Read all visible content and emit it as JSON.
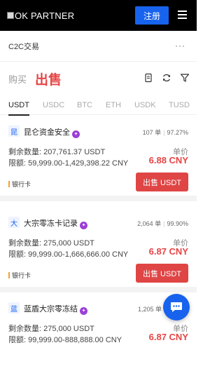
{
  "header": {
    "logo_text": "OK PARTNER",
    "register_label": "注册"
  },
  "subhead": {
    "title": "C2C交易",
    "more": "···"
  },
  "mode_tabs": {
    "buy": "购买",
    "sell": "出售"
  },
  "coins": [
    "USDT",
    "USDC",
    "BTC",
    "ETH",
    "USDK",
    "TUSD"
  ],
  "active_coin": "USDT",
  "listings": [
    {
      "avatar": "昆",
      "name": "昆仑资金安全",
      "orders": "107 单",
      "completion": "97.27%",
      "qty": "剩余数量: 207,761.37 USDT",
      "limit": "限额: 59,999.00-1,429,398.22 CNY",
      "price_label": "单价",
      "price": "6.88 CNY",
      "pay": "银行卡",
      "action": "出售 USDT"
    },
    {
      "avatar": "大",
      "name": "大宗零冻卡记录",
      "orders": "2,064 单",
      "completion": "99.90%",
      "qty": "剩余数量: 275,000 USDT",
      "limit": "限额: 99,999.00-1,666,666.00 CNY",
      "price_label": "单价",
      "price": "6.87 CNY",
      "pay": "银行卡",
      "action": "出售 USDT"
    },
    {
      "avatar": "蓝",
      "name": "蓝盾大宗零冻结",
      "orders": "1,205 单",
      "completion": "",
      "qty": "剩余数量: 275,000 USDT",
      "limit": "限额: 99,999.00-888,888.00 CNY",
      "price_label": "单价",
      "price": "6.87 CNY",
      "pay": "",
      "action": ""
    }
  ],
  "colors": {
    "brand": "#1763ee",
    "sell": "#e64545",
    "badge": "#9b3fd6"
  }
}
